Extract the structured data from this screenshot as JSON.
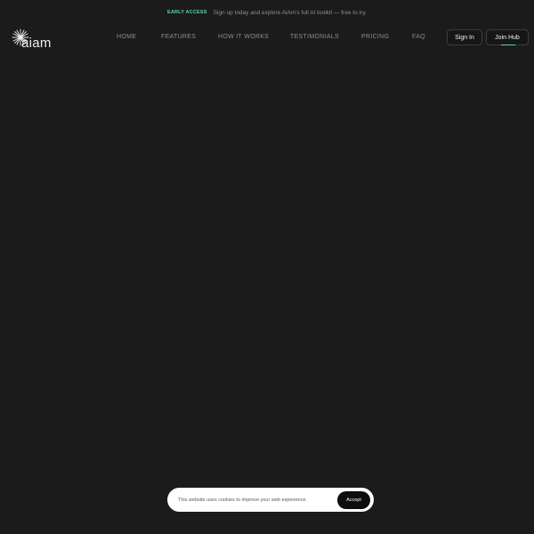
{
  "announcement": {
    "tag": "EARLY ACCESS",
    "text": "Sign up today and explore AiAm's full AI toolkit — free to try."
  },
  "header": {
    "logo_text": "aiam",
    "nav": [
      "HOME",
      "FEATURES",
      "HOW IT WORKS",
      "TESTIMONIALS",
      "PRICING",
      "FAQ"
    ],
    "signin_label": "Sign In",
    "join_label": "Join Hub"
  },
  "cookie_banner": {
    "text": "This website uses cookies to improve your web experience.",
    "accept_label": "Accept"
  },
  "colors": {
    "background": "#1b1b1c",
    "accent": "#5fd3a6",
    "nav_text": "#8d8d92",
    "banner_bg": "#ffffff",
    "accept_bg": "#0d0d0e"
  }
}
